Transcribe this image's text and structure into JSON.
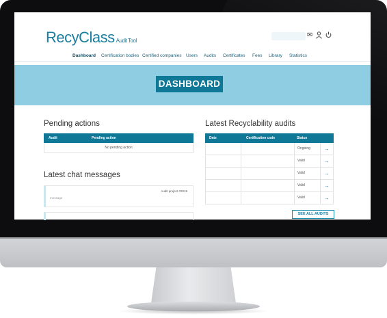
{
  "app": {
    "logo_main": "RecyClass",
    "logo_sub": "Audit Tool"
  },
  "header": {
    "icons": [
      "mail-icon",
      "user-icon",
      "power-icon"
    ]
  },
  "nav": {
    "items": [
      {
        "label": "Dashboard",
        "active": true
      },
      {
        "label": "Certification bodies"
      },
      {
        "label": "Certified companies"
      },
      {
        "label": "Users"
      },
      {
        "label": "Audits"
      },
      {
        "label": "Certificates"
      },
      {
        "label": "Fees"
      },
      {
        "label": "Library"
      },
      {
        "label": "Statistics"
      }
    ]
  },
  "banner": {
    "title": "DASHBOARD"
  },
  "pending": {
    "title": "Pending actions",
    "columns": [
      "Audit",
      "Pending action"
    ],
    "empty_text": "No pending action"
  },
  "chat": {
    "title": "Latest chat messages",
    "messages": [
      {
        "author": "Audit project #2015",
        "text": "message"
      }
    ]
  },
  "audits": {
    "title": "Latest Recyclability audits",
    "columns": [
      "Date",
      "Certification code",
      "Status"
    ],
    "rows": [
      {
        "date": "",
        "code": "",
        "status": "Ongoing"
      },
      {
        "date": "",
        "code": "",
        "status": "Valid"
      },
      {
        "date": "",
        "code": "",
        "status": "Valid"
      },
      {
        "date": "",
        "code": "",
        "status": "Valid"
      },
      {
        "date": "",
        "code": "",
        "status": "Valid"
      }
    ],
    "row_action_icon": "arrow-right-icon",
    "see_all_label": "SEE ALL AUDITS"
  },
  "colors": {
    "brand": "#1b7ea0",
    "header_bar": "#0f7896",
    "banner_bg": "#8fcde2"
  }
}
